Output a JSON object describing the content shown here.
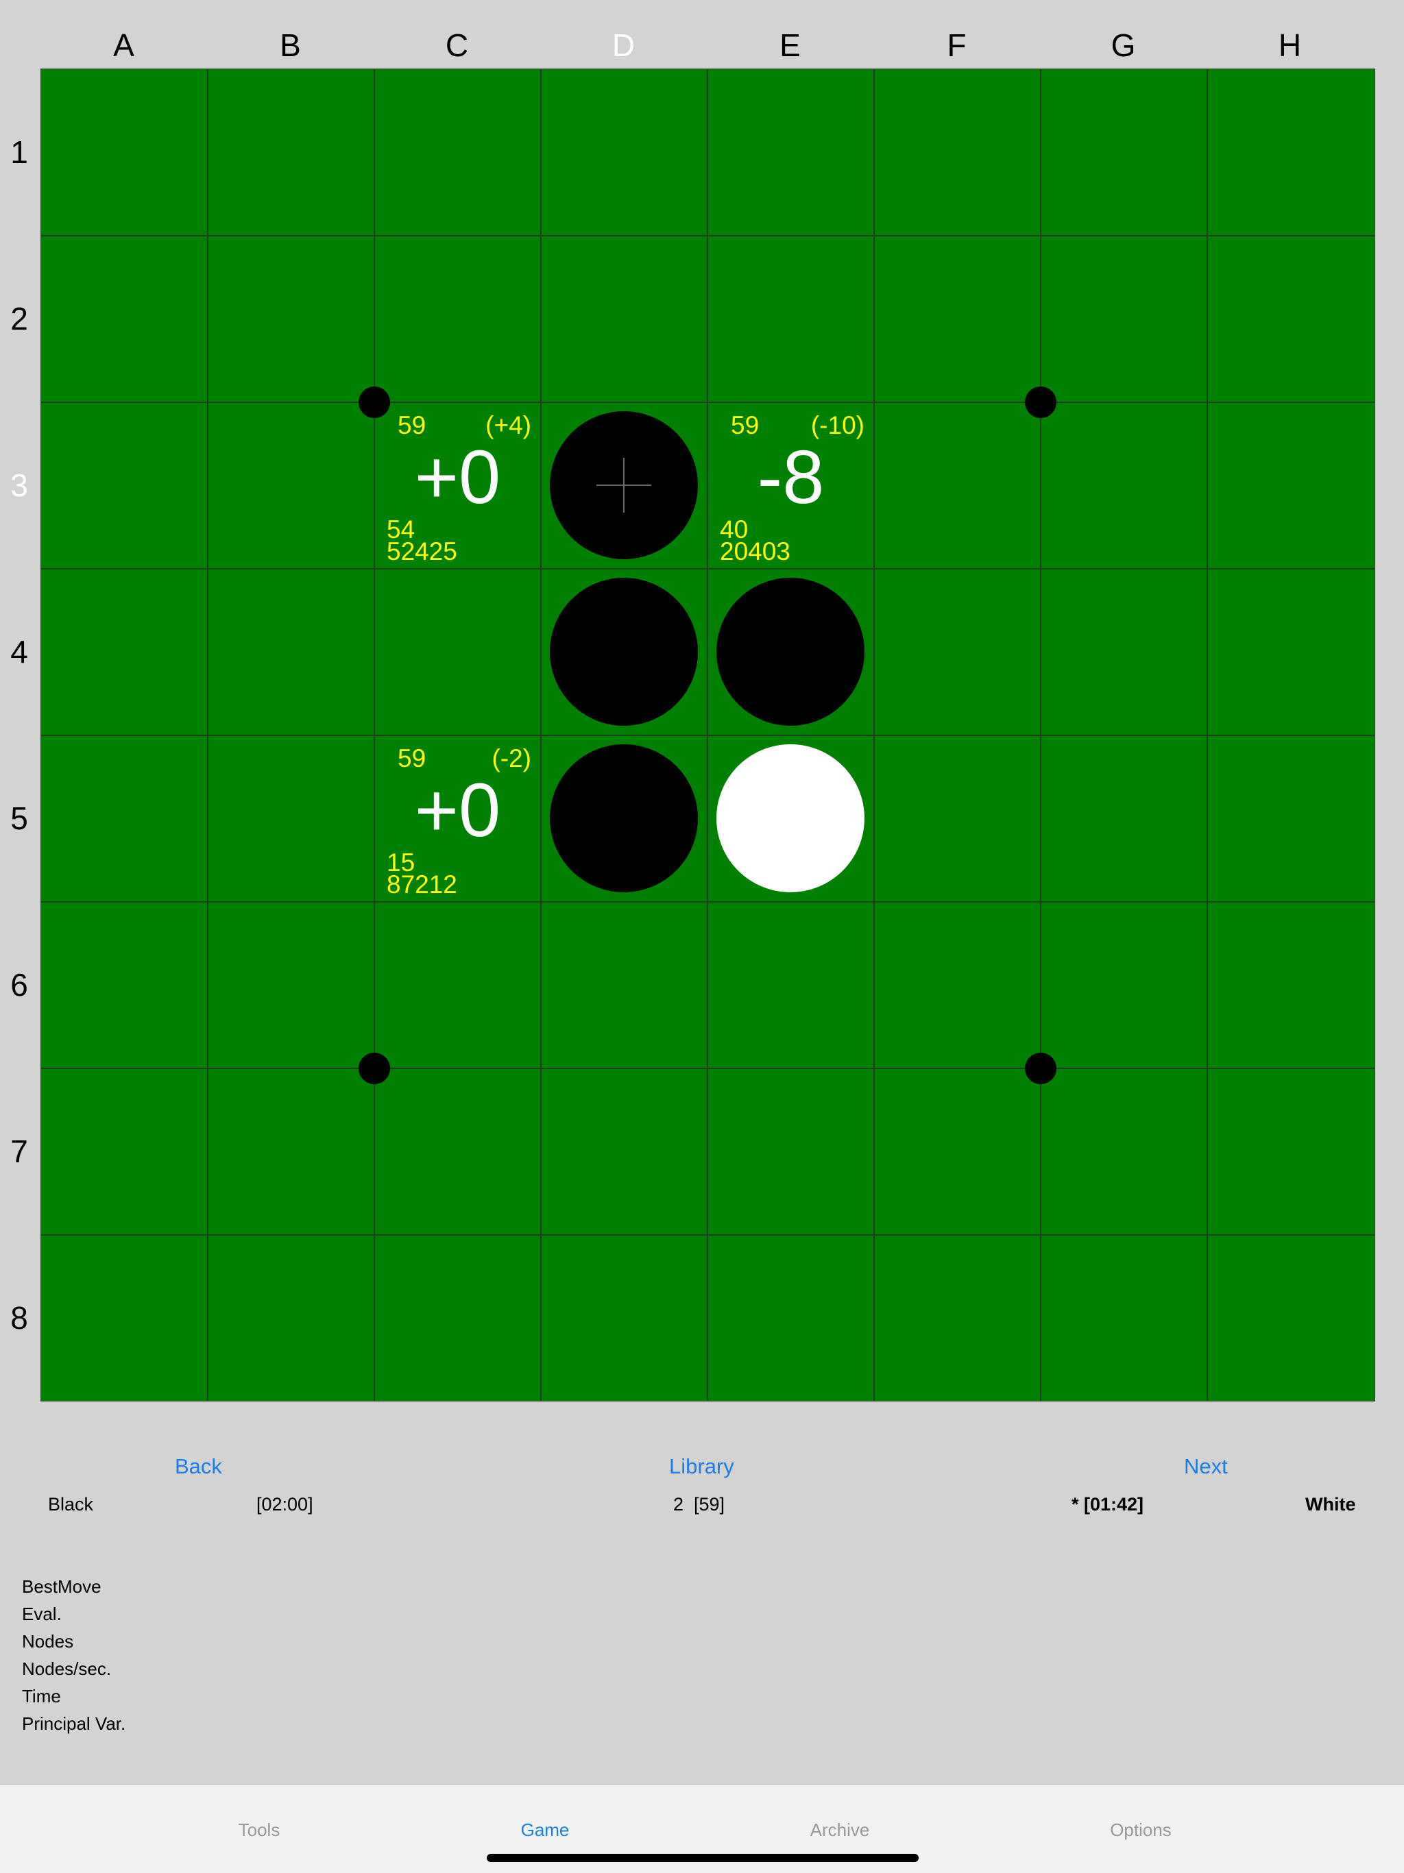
{
  "board": {
    "columns": [
      "A",
      "B",
      "C",
      "D",
      "E",
      "F",
      "G",
      "H"
    ],
    "rows": [
      "1",
      "2",
      "3",
      "4",
      "5",
      "6",
      "7",
      "8"
    ],
    "highlighted_column": "D",
    "highlighted_row": "3",
    "colors": {
      "board": "#008000",
      "eval_text": "#ffff00",
      "score_text": "#ffffff"
    },
    "discs": [
      {
        "cell": "D3",
        "color": "black",
        "last_move_marker": true
      },
      {
        "cell": "D4",
        "color": "black"
      },
      {
        "cell": "E4",
        "color": "black"
      },
      {
        "cell": "D5",
        "color": "black"
      },
      {
        "cell": "E5",
        "color": "white"
      }
    ],
    "move_evals": [
      {
        "cell": "C3",
        "depth": "59",
        "delta": "(+4)",
        "score": "+0",
        "nodes_a": "54",
        "nodes_b": "52425"
      },
      {
        "cell": "E3",
        "depth": "59",
        "delta": "(-10)",
        "score": "-8",
        "nodes_a": "40",
        "nodes_b": "20403"
      },
      {
        "cell": "C5",
        "depth": "59",
        "delta": "(-2)",
        "score": "+0",
        "nodes_a": "15",
        "nodes_b": "87212"
      }
    ]
  },
  "controls": {
    "back": "Back",
    "library": "Library",
    "next": "Next"
  },
  "game_info": {
    "black_label": "Black",
    "black_time": "[02:00]",
    "move_info": "2  [59]",
    "white_time": "* [01:42]",
    "white_label": "White"
  },
  "stats_labels": [
    "BestMove",
    "Eval.",
    "Nodes",
    "Nodes/sec.",
    "Time",
    "Principal Var."
  ],
  "tabs": [
    {
      "label": "Tools",
      "active": false
    },
    {
      "label": "Game",
      "active": true
    },
    {
      "label": "Archive",
      "active": false
    },
    {
      "label": "Options",
      "active": false
    }
  ],
  "accent_color": "#1a7fea"
}
